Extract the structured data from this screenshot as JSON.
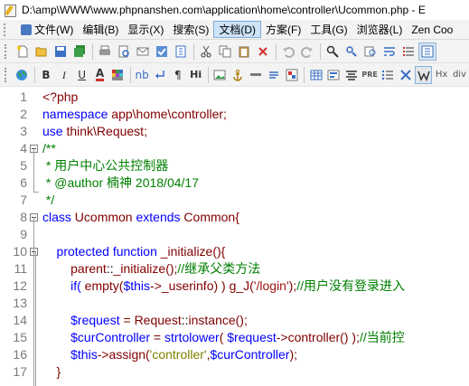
{
  "window": {
    "title": "D:\\amp\\WWW\\www.phpnanshen.com\\application\\home\\controller\\Ucommon.php - E"
  },
  "menu": [
    {
      "label": "文件(W)",
      "icon_color": "#4a79c4"
    },
    {
      "label": "编辑(B)",
      "icon_color": ""
    },
    {
      "label": "显示(X)",
      "icon_color": ""
    },
    {
      "label": "搜索(S)",
      "icon_color": ""
    },
    {
      "label": "文档(D)",
      "icon_color": ""
    },
    {
      "label": "方案(F)",
      "icon_color": ""
    },
    {
      "label": "工具(G)",
      "icon_color": ""
    },
    {
      "label": "浏览器(L)",
      "icon_color": ""
    },
    {
      "label": "Zen Coo",
      "icon_color": ""
    }
  ],
  "toolbar2_text": {
    "bold": "B",
    "italic": "I",
    "underline": "U",
    "font_color": "A",
    "nb": "nb",
    "paragraph": "¶",
    "heading": "Hi",
    "pre": "PRE",
    "hx": "Hx",
    "div": "div"
  },
  "editor": {
    "lines": [
      {
        "n": "1",
        "tokens": [
          {
            "t": "<?php",
            "c": "c-kw"
          }
        ]
      },
      {
        "n": "2",
        "tokens": [
          {
            "t": "namespace ",
            "c": "c-ns"
          },
          {
            "t": "app\\home\\controller;",
            "c": "c-kw"
          }
        ]
      },
      {
        "n": "3",
        "tokens": [
          {
            "t": "use ",
            "c": "c-ns"
          },
          {
            "t": "think\\Request;",
            "c": "c-kw"
          }
        ]
      },
      {
        "n": "4",
        "fold": true,
        "tokens": [
          {
            "t": "/**",
            "c": "c-cm"
          }
        ]
      },
      {
        "n": "5",
        "tokens": [
          {
            "t": " * 用户中心公共控制器",
            "c": "c-cm"
          }
        ]
      },
      {
        "n": "6",
        "tokens": [
          {
            "t": " * @author 楠神 2018/04/17",
            "c": "c-cm"
          }
        ]
      },
      {
        "n": "7",
        "tokens": [
          {
            "t": " */",
            "c": "c-cm"
          }
        ]
      },
      {
        "n": "8",
        "fold": true,
        "tokens": [
          {
            "t": "class ",
            "c": "c-ns"
          },
          {
            "t": "Ucommon ",
            "c": "c-kw"
          },
          {
            "t": "extends ",
            "c": "c-ns"
          },
          {
            "t": "Common{",
            "c": "c-kw"
          }
        ]
      },
      {
        "n": "9",
        "tokens": []
      },
      {
        "n": "10",
        "fold": true,
        "tokens": [
          {
            "t": "    protected function ",
            "c": "c-ns"
          },
          {
            "t": "_initialize(){",
            "c": "c-kw"
          }
        ]
      },
      {
        "n": "11",
        "tokens": [
          {
            "t": "        parent",
            "c": "c-kw"
          },
          {
            "t": "::",
            "c": "c-op"
          },
          {
            "t": "_initialize();",
            "c": "c-kw"
          },
          {
            "t": "//继承父类方法",
            "c": "c-cm"
          }
        ]
      },
      {
        "n": "12",
        "tokens": [
          {
            "t": "        if( ",
            "c": "c-ns"
          },
          {
            "t": "empty(",
            "c": "c-kw"
          },
          {
            "t": "$this",
            "c": "c-var"
          },
          {
            "t": "->_userinfo) ) g_J(",
            "c": "c-kw"
          },
          {
            "t": "'/login'",
            "c": "c-str2"
          },
          {
            "t": ");",
            "c": "c-kw"
          },
          {
            "t": "//用户没有登录进入",
            "c": "c-cm"
          }
        ]
      },
      {
        "n": "13",
        "tokens": []
      },
      {
        "n": "14",
        "tokens": [
          {
            "t": "        $request",
            "c": "c-var"
          },
          {
            "t": " = Request",
            "c": "c-kw"
          },
          {
            "t": "::",
            "c": "c-op"
          },
          {
            "t": "instance();",
            "c": "c-kw"
          }
        ]
      },
      {
        "n": "15",
        "tokens": [
          {
            "t": "        $curController",
            "c": "c-var"
          },
          {
            "t": " = ",
            "c": "c-kw"
          },
          {
            "t": "strtolower",
            "c": "c-fn"
          },
          {
            "t": "( ",
            "c": "c-kw"
          },
          {
            "t": "$request",
            "c": "c-var"
          },
          {
            "t": "->controller() );",
            "c": "c-kw"
          },
          {
            "t": "//当前控",
            "c": "c-cm"
          }
        ]
      },
      {
        "n": "16",
        "tokens": [
          {
            "t": "        $this",
            "c": "c-var"
          },
          {
            "t": "->assign(",
            "c": "c-kw"
          },
          {
            "t": "'controller'",
            "c": "c-str"
          },
          {
            "t": ",",
            "c": "c-kw"
          },
          {
            "t": "$curController",
            "c": "c-var"
          },
          {
            "t": ");",
            "c": "c-kw"
          }
        ]
      },
      {
        "n": "17",
        "tokens": [
          {
            "t": "    }",
            "c": "c-kw"
          }
        ]
      }
    ]
  }
}
